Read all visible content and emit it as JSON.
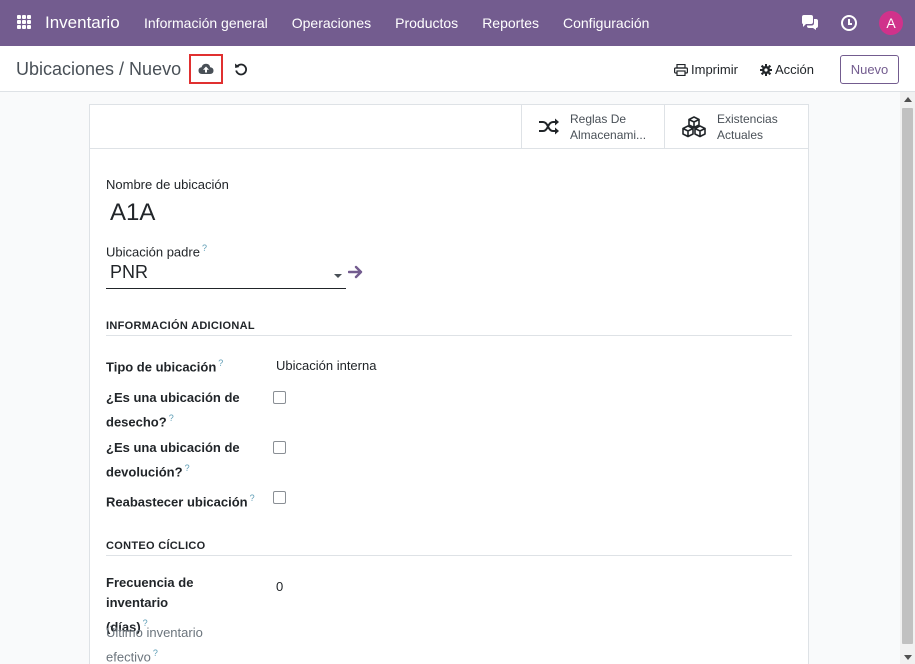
{
  "navbar": {
    "app_name": "Inventario",
    "menu": [
      "Información general",
      "Operaciones",
      "Productos",
      "Reportes",
      "Configuración"
    ],
    "avatar_letter": "A",
    "avatar_color": "#d0328b",
    "bg_color": "#735c8f"
  },
  "control": {
    "breadcrumb": "Ubicaciones / Nuevo",
    "print_label": "Imprimir",
    "action_label": "Acción",
    "new_label": "Nuevo"
  },
  "smart_buttons": {
    "rules_line1": "Reglas De",
    "rules_line2": "Almacenami...",
    "stock_line1": "Existencias",
    "stock_line2": "Actuales"
  },
  "form": {
    "name_label": "Nombre de ubicación",
    "name_value": "A1A",
    "parent_label": "Ubicación padre",
    "parent_value": "PNR",
    "help_mark": "?",
    "section_additional": "INFORMACIÓN ADICIONAL",
    "type_label": "Tipo de ubicación",
    "type_value": "Ubicación interna",
    "scrap_label_l1": "¿Es una ubicación de",
    "scrap_label_l2": "desecho?",
    "return_label_l1": "¿Es una ubicación de",
    "return_label_l2": "devolución?",
    "replenish_label": "Reabastecer ubicación",
    "section_cycle": "CONTEO CÍCLICO",
    "freq_label_l1": "Frecuencia de inventario",
    "freq_label_l2": "(días)",
    "freq_value": "0",
    "last_label_l1": "Último inventario",
    "last_label_l2": "efectivo"
  }
}
